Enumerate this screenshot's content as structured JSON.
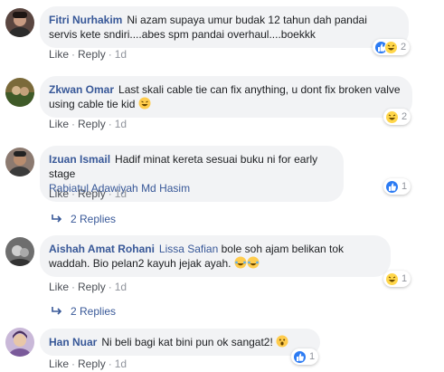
{
  "comments": [
    {
      "author": "Fitri Nurhakim",
      "text": "Ni azam supaya umur budak 12 tahun dah pandai servis kete sndiri....abes spm pandai overhaul....boekkk",
      "like": "Like",
      "reply": "Reply",
      "time": "1d",
      "reaction_count": "2",
      "reactions": [
        "like-icon",
        "haha-icon"
      ]
    },
    {
      "author": "Zkwan Omar",
      "text": "Last skali cable tie can fix anything, u dont fix broken valve using cable tie kid",
      "like": "Like",
      "reply": "Reply",
      "time": "1d",
      "reaction_count": "2",
      "reactions": [
        "haha-icon"
      ]
    },
    {
      "author": "Izuan Ismail",
      "text": "Hadif minat kereta sesuai buku ni for early stage",
      "mention": "Rabiatul Adawiyah Md Hasim",
      "like": "Like",
      "reply": "Reply",
      "time": "1d",
      "reaction_count": "1",
      "reactions": [
        "like-icon"
      ],
      "replies_label": "2 Replies"
    },
    {
      "author": "Aishah Amat Rohani",
      "mention": "Lissa Safian",
      "text": "bole soh ajam belikan tok waddah. Bio pelan2 kayuh jejak ayah.",
      "like": "Like",
      "reply": "Reply",
      "time": "1d",
      "reaction_count": "1",
      "reactions": [
        "haha-icon"
      ],
      "replies_label": "2 Replies"
    },
    {
      "author": "Han Nuar",
      "text": "Ni beli bagi kat bini pun ok sangat2!",
      "like": "Like",
      "reply": "Reply",
      "time": "1d",
      "reaction_count": "1",
      "reactions": [
        "like-icon"
      ]
    }
  ],
  "colors": {
    "link": "#385898",
    "bubble": "#f2f3f5",
    "meta": "#90949c",
    "like_blue": "#2c7bf3",
    "haha_yellow": "#ffd64a"
  }
}
